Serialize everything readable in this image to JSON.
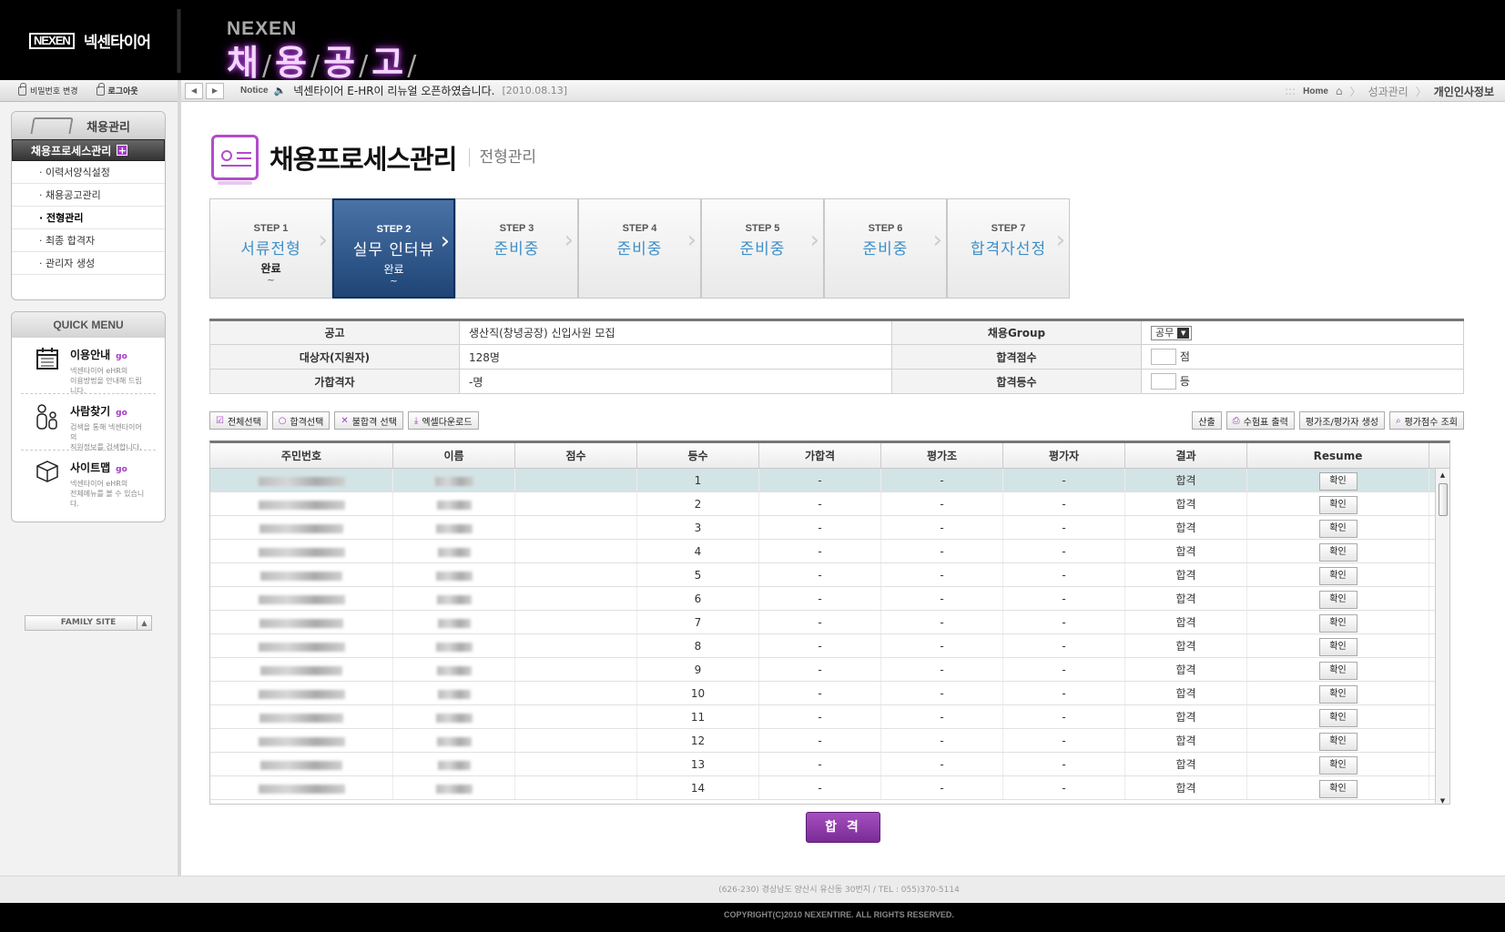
{
  "header": {
    "logo_mark": "NEXEN",
    "logo_name": "넥센타이어",
    "brand_top": "NEXEN",
    "brand_chars": [
      "채",
      "용",
      "공",
      "고"
    ]
  },
  "sidebar": {
    "util": {
      "change_pw": "비밀번호 변경",
      "logout": "로그아웃"
    },
    "menu_title": "채용관리",
    "active_menu": "채용프로세스관리",
    "items": [
      {
        "label": "· 이력서양식설정"
      },
      {
        "label": "· 채용공고관리"
      },
      {
        "label": "· 전형관리"
      },
      {
        "label": "· 최종 합격자"
      },
      {
        "label": "· 관리자 생성"
      }
    ],
    "quick_menu": {
      "title": "QUICK MENU",
      "go": "go",
      "items": [
        {
          "title": "이용안내",
          "desc1": "넥센타이어 eHR의",
          "desc2": "이용방법을 안내해 드립니다."
        },
        {
          "title": "사람찾기",
          "desc1": "검색을 통해 넥센타이어의",
          "desc2": "직원정보를 검색합니다."
        },
        {
          "title": "사이트맵",
          "desc1": "넥센타이어 eHR의",
          "desc2": "전체메뉴를 볼 수 있습니다."
        }
      ]
    },
    "family_site": "FAMILY SITE"
  },
  "notice": {
    "label": "Notice",
    "text": "넥센타이어 E-HR이 리뉴얼 오픈하였습니다.",
    "date": "[2010.08.13]"
  },
  "breadcrumb": {
    "home": "Home",
    "level1": "성과관리",
    "current": "개인인사정보"
  },
  "page": {
    "title": "채용프로세스관리",
    "subtitle": "전형관리"
  },
  "steps": [
    {
      "no": "STEP 1",
      "title": "서류전형",
      "status": "완료",
      "range": "~"
    },
    {
      "no": "STEP 2",
      "title": "실무 인터뷰",
      "status": "완료",
      "range": "~"
    },
    {
      "no": "STEP 3",
      "title": "준비중",
      "status": "",
      "range": ""
    },
    {
      "no": "STEP 4",
      "title": "준비중",
      "status": "",
      "range": ""
    },
    {
      "no": "STEP 5",
      "title": "준비중",
      "status": "",
      "range": ""
    },
    {
      "no": "STEP 6",
      "title": "준비중",
      "status": "",
      "range": ""
    },
    {
      "no": "STEP 7",
      "title": "합격자선정",
      "status": "",
      "range": ""
    }
  ],
  "info": {
    "notice_label": "공고",
    "notice_value": "생산직(창녕공장) 신입사원 모집",
    "group_label": "채용Group",
    "group_value": "공무",
    "applicants_label": "대상자(지원자)",
    "applicants_value": "128명",
    "pass_score_label": "합격점수",
    "pass_score_unit": "점",
    "tentative_label": "가합격자",
    "tentative_value": "-명",
    "pass_rank_label": "합격등수",
    "pass_rank_unit": "등"
  },
  "toolbar_left": {
    "select_all": "전체선택",
    "select_pass": "합격선택",
    "select_fail": "불합격 선택",
    "excel": "엑셀다운로드"
  },
  "toolbar_right": {
    "calc": "산출",
    "print": "수험표 출력",
    "create_eval": "평가조/평가자 생성",
    "view_score": "평가점수 조회"
  },
  "table": {
    "columns": [
      "주민번호",
      "이름",
      "점수",
      "등수",
      "가합격",
      "평가조",
      "평가자",
      "결과",
      "Resume"
    ],
    "rows": [
      {
        "rank": "1",
        "tentative": "-",
        "group": "-",
        "evaluator": "-",
        "result": "합격",
        "resume": "확인"
      },
      {
        "rank": "2",
        "tentative": "-",
        "group": "-",
        "evaluator": "-",
        "result": "합격",
        "resume": "확인"
      },
      {
        "rank": "3",
        "tentative": "-",
        "group": "-",
        "evaluator": "-",
        "result": "합격",
        "resume": "확인"
      },
      {
        "rank": "4",
        "tentative": "-",
        "group": "-",
        "evaluator": "-",
        "result": "합격",
        "resume": "확인"
      },
      {
        "rank": "5",
        "tentative": "-",
        "group": "-",
        "evaluator": "-",
        "result": "합격",
        "resume": "확인"
      },
      {
        "rank": "6",
        "tentative": "-",
        "group": "-",
        "evaluator": "-",
        "result": "합격",
        "resume": "확인"
      },
      {
        "rank": "7",
        "tentative": "-",
        "group": "-",
        "evaluator": "-",
        "result": "합격",
        "resume": "확인"
      },
      {
        "rank": "8",
        "tentative": "-",
        "group": "-",
        "evaluator": "-",
        "result": "합격",
        "resume": "확인"
      },
      {
        "rank": "9",
        "tentative": "-",
        "group": "-",
        "evaluator": "-",
        "result": "합격",
        "resume": "확인"
      },
      {
        "rank": "10",
        "tentative": "-",
        "group": "-",
        "evaluator": "-",
        "result": "합격",
        "resume": "확인"
      },
      {
        "rank": "11",
        "tentative": "-",
        "group": "-",
        "evaluator": "-",
        "result": "합격",
        "resume": "확인"
      },
      {
        "rank": "12",
        "tentative": "-",
        "group": "-",
        "evaluator": "-",
        "result": "합격",
        "resume": "확인"
      },
      {
        "rank": "13",
        "tentative": "-",
        "group": "-",
        "evaluator": "-",
        "result": "합격",
        "resume": "확인"
      },
      {
        "rank": "14",
        "tentative": "-",
        "group": "-",
        "evaluator": "-",
        "result": "합격",
        "resume": "확인"
      }
    ]
  },
  "pass_button": "합 격",
  "footer": {
    "address": "(626-230) 경상남도 양산시 유산동 30번지   /   TEL : 055)370-5114",
    "copyright": "COPYRIGHT(C)2010 NEXENTIRE. ALL RIGHTS RESERVED."
  }
}
